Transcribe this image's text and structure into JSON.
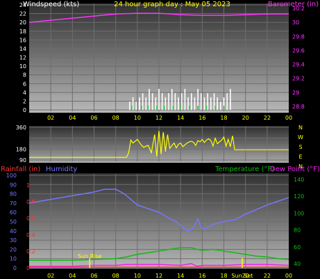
{
  "title": "24 hour graph day : May 05 2023",
  "colors": {
    "bg": "#000000",
    "grid": "#6e6e6e",
    "panel_top": "#303030",
    "panel_bottom": "#b8b8b8",
    "title": "#ffff00",
    "baro": "#ff33ff",
    "wind": "#ffffff",
    "gust": "#33cc33",
    "dir": "#ffff00",
    "rain": "#ff3333",
    "humidity": "#7777ff",
    "temperature": "#11bb11",
    "dewpoint": "#ee22ee",
    "sunmarker": "#ffff00"
  },
  "x_ticks": [
    "02",
    "04",
    "06",
    "08",
    "10",
    "12",
    "14",
    "16",
    "18",
    "20",
    "22",
    "00"
  ],
  "panel1": {
    "left_label": "Windspeed (kts)",
    "right_label": "Barometer (in)",
    "left_ticks": [
      "24",
      "22",
      "20",
      "18",
      "16",
      "14",
      "12",
      "10",
      "8",
      "6",
      "4",
      "2",
      "0"
    ],
    "right_ticks": [
      "30.2",
      "30",
      "29.8",
      "29.6",
      "29.4",
      "29.2",
      "29",
      "28.8"
    ]
  },
  "panel2": {
    "left_ticks": [
      "360",
      "180",
      "90"
    ],
    "compass": [
      "N",
      "W",
      "S",
      "E",
      "N"
    ]
  },
  "panel3": {
    "rain_label": "Rainfall (in)",
    "humidity_label": "Humidity",
    "temp_label": "Temperature (°F)",
    "dew_label": "Dew Point (°F)",
    "hum_ticks": [
      "100",
      "90",
      "80",
      "70",
      "60",
      "50",
      "40",
      "30",
      "20",
      "10",
      "0"
    ],
    "rain_ticks": [
      "1",
      "0.8",
      "0.6",
      "0.4",
      "0.2",
      "0"
    ],
    "temp_ticks": [
      "140",
      "120",
      "100",
      "80",
      "60",
      "40"
    ],
    "sunrise_label": "Sun Rise",
    "sunset_label": "Sun Set"
  },
  "chart_data": [
    {
      "type": "line",
      "title": "24 hour graph day : May 05 2023",
      "x_unit": "hour",
      "xlim": [
        0,
        24
      ],
      "ylabel": "Windspeed (kts)",
      "ylim": [
        0,
        25
      ],
      "y2label": "Barometer (in)",
      "y2lim": [
        28.75,
        30.25
      ],
      "grid": true,
      "series": [
        {
          "name": "Barometer (in)",
          "axis": "right",
          "x": [
            0,
            2,
            4,
            6,
            8,
            10,
            12,
            14,
            16,
            18,
            20,
            22,
            24
          ],
          "values": [
            30.0,
            30.03,
            30.06,
            30.09,
            30.12,
            30.13,
            30.13,
            30.11,
            30.1,
            30.1,
            30.11,
            30.12,
            30.12
          ]
        },
        {
          "axis": "left",
          "style": "spikes",
          "x": [
            9.3,
            9.6,
            9.9,
            10.2,
            10.5,
            10.8,
            11.1,
            11.4,
            11.7,
            12.0,
            12.3,
            12.6,
            12.9,
            13.2,
            13.5,
            13.8,
            14.1,
            14.4,
            14.7,
            15.0,
            15.3,
            15.6,
            15.9,
            16.2,
            16.5,
            16.8,
            17.1,
            17.4,
            17.7,
            18.0,
            18.3,
            18.6
          ],
          "values": [
            2,
            3,
            2,
            3,
            4,
            3,
            5,
            4,
            3,
            5,
            4,
            3,
            4,
            5,
            4,
            3,
            4,
            5,
            3,
            4,
            3,
            5,
            4,
            3,
            4,
            3,
            4,
            3,
            2,
            3,
            4,
            5
          ]
        },
        {
          "axis": "left",
          "style": "spikes",
          "x": [
            9.5,
            10.4,
            11.0,
            11.8,
            12.5,
            13.3,
            14.0,
            14.8,
            15.6,
            16.4,
            17.2,
            18.0
          ],
          "values": [
            1,
            1,
            1,
            1,
            1,
            1,
            1,
            1,
            1,
            1,
            1,
            1
          ]
        }
      ]
    },
    {
      "type": "line",
      "x_unit": "hour",
      "xlim": [
        0,
        24
      ],
      "ylim": [
        90,
        360
      ],
      "series": [
        {
          "x": [
            0,
            9.0,
            9.2,
            9.4,
            9.6,
            10.0,
            10.4,
            10.6,
            10.8,
            11.0,
            11.3,
            11.6,
            11.8,
            12.0,
            12.2,
            12.4,
            12.6,
            12.8,
            13.0,
            13.2,
            13.4,
            13.6,
            13.8,
            14.0,
            14.2,
            14.4,
            14.6,
            14.8,
            15.0,
            15.2,
            15.4,
            15.6,
            15.8,
            16.0,
            16.2,
            16.4,
            16.6,
            16.8,
            17.0,
            17.2,
            17.4,
            17.6,
            17.8,
            18.0,
            18.2,
            18.4,
            18.6,
            18.8,
            19.0,
            24
          ],
          "values": [
            112,
            112,
            150,
            255,
            230,
            260,
            210,
            195,
            205,
            210,
            150,
            300,
            120,
            330,
            140,
            320,
            160,
            300,
            185,
            210,
            230,
            190,
            220,
            230,
            200,
            215,
            230,
            240,
            245,
            235,
            210,
            250,
            240,
            260,
            235,
            255,
            265,
            250,
            205,
            270,
            225,
            240,
            255,
            280,
            205,
            260,
            200,
            290,
            175,
            175
          ]
        }
      ]
    },
    {
      "type": "line",
      "x_unit": "hour",
      "xlim": [
        0,
        24
      ],
      "ylabel": "Humidity",
      "ylim": [
        0,
        100
      ],
      "y2label": "Temperature (°F)",
      "y2lim": [
        35,
        145
      ],
      "grid": true,
      "series": [
        {
          "name": "Humidity",
          "axis": "left",
          "x": [
            0,
            2,
            4,
            6,
            7,
            8,
            8.8,
            9.5,
            10,
            11,
            12,
            12.6,
            13,
            13.6,
            14,
            14.3,
            14.6,
            15,
            15.3,
            15.6,
            15.9,
            16.2,
            16.6,
            17,
            18,
            19,
            20,
            21,
            22,
            23,
            24
          ],
          "values": [
            70,
            74,
            78,
            82,
            85,
            85,
            80,
            73,
            68,
            64,
            60,
            56,
            53,
            50,
            46,
            43,
            40,
            41,
            46,
            53,
            44,
            42,
            44,
            47,
            50,
            52,
            58,
            63,
            68,
            72,
            76
          ]
        },
        {
          "name": "Temperature (°F)",
          "axis": "right",
          "x": [
            0,
            4,
            6,
            8,
            9,
            10,
            11,
            12,
            13,
            14,
            15,
            15.5,
            16,
            17,
            18,
            19,
            20,
            21,
            22,
            23,
            24
          ],
          "values": [
            44,
            44,
            45,
            46,
            48,
            51,
            53,
            55,
            57,
            59,
            59,
            57,
            56,
            57,
            55,
            53,
            51,
            49,
            48,
            46,
            45
          ]
        },
        {
          "name": "Dew Point (°F)",
          "axis": "right",
          "x": [
            0,
            4,
            6,
            8,
            9,
            10,
            12,
            14,
            15,
            15.5,
            16,
            18,
            20,
            22,
            24
          ],
          "values": [
            37,
            37,
            38,
            38,
            39,
            39,
            39,
            38,
            40,
            37,
            38,
            38,
            39,
            39,
            38
          ]
        },
        {
          "name": "Rainfall (in)",
          "axis": "rain",
          "x": [
            0,
            24
          ],
          "values": [
            0,
            0
          ]
        }
      ],
      "markers": [
        {
          "label": "Sun Rise",
          "x": 5.6
        },
        {
          "label": "Sun Set",
          "x": 19.7
        }
      ]
    }
  ]
}
